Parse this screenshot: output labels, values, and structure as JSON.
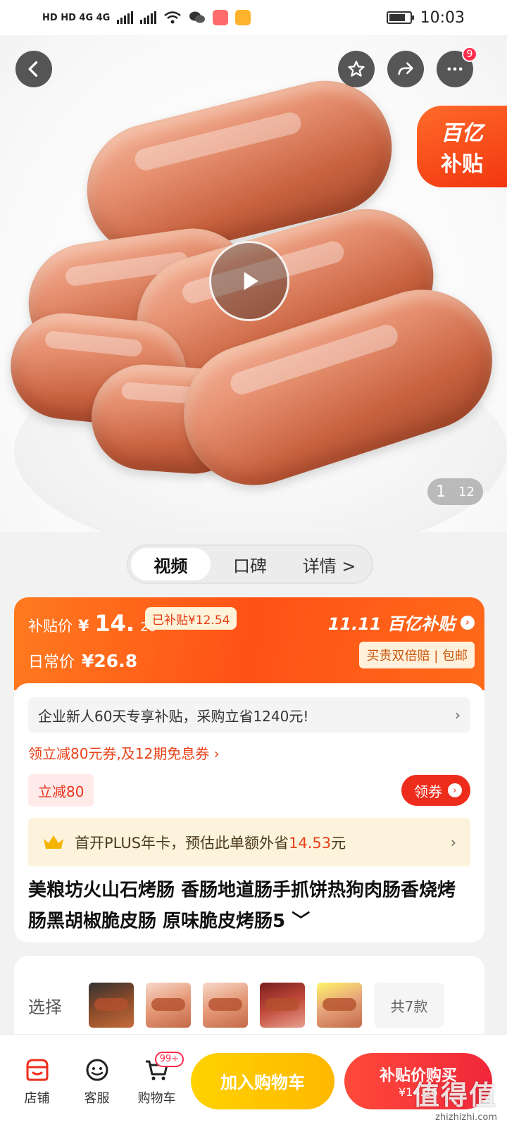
{
  "status_bar": {
    "left_text": "HD HD 4G 4G",
    "time": "10:03"
  },
  "hero": {
    "subsidy_tag_line1": "百亿",
    "subsidy_tag_line2": "补贴",
    "more_badge": "9",
    "image_index": "1",
    "image_total": "12"
  },
  "tabs": [
    {
      "label": "视频",
      "active": true
    },
    {
      "label": "口碑",
      "active": false
    },
    {
      "label": "详情 >",
      "active": false
    }
  ],
  "price": {
    "subsidy_label": "补贴价",
    "subsidy_yen": "¥",
    "subsidy_int": "14.",
    "subsidy_dec": "26",
    "already_subsidized": "已补贴¥12.54",
    "regular_label": "日常价",
    "regular_value": "¥26.8",
    "brand": "11.11 百亿补贴",
    "guarantee": "买贵双倍赔 | 包邮"
  },
  "promos": {
    "enterprise": "企业新人60天专享补贴，采购立省1240元!",
    "coupon_line": "领立减80元券,及12期免息券 ›",
    "lijian": "立减80",
    "lingquan": "领券",
    "plus_prefix": "首开PLUS年卡，预估此单额外省",
    "plus_amount": "14.53",
    "plus_suffix": "元"
  },
  "product": {
    "title": "美粮坊火山石烤肠 香肠地道肠手抓饼热狗肉肠香烧烤肠黑胡椒脆皮肠 原味脆皮烤肠5 ﹀"
  },
  "selection": {
    "label": "选择",
    "more": "共7款"
  },
  "bottom_bar": {
    "shop": "店铺",
    "service": "客服",
    "cart": "购物车",
    "cart_badge": "99+",
    "add_to_cart": "加入购物车",
    "buy_main": "补贴价购买",
    "buy_sub": "¥14.26"
  },
  "watermark": {
    "big": "值得值",
    "small": "zhizhizhi.com"
  },
  "colors": {
    "accent_orange": "#ff5216",
    "accent_red": "#ee2c1c",
    "cart_yellow": "#ffc400"
  }
}
